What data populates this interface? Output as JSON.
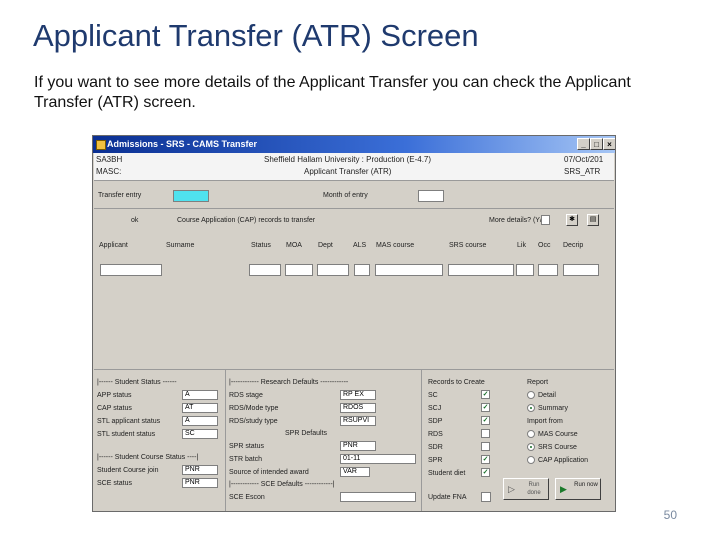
{
  "slide": {
    "title": "Applicant Transfer (ATR) Screen",
    "body": "If you want to see more details of the Applicant Transfer you can check the Applicant Transfer (ATR) screen.",
    "page_number": "50"
  },
  "window": {
    "title": "Admissions - SRS - CAMS Transfer",
    "header": {
      "left_top": "SA3BH",
      "left_bottom": "MASC:",
      "center_top": "Sheffield Hallam University : Production (E-4.7)",
      "center_bottom": "Applicant Transfer (ATR)",
      "right_top": "07/Oct/201",
      "right_bottom": "SRS_ATR"
    },
    "filters": {
      "transfer_label": "Transfer entry",
      "month_label": "Month of entry",
      "ok_label": "ok",
      "records_label": "Course Application (CAP) records to transfer",
      "more_details_label": "More details? (Y/N)"
    },
    "columns": [
      "Applicant",
      "Surname",
      "Status",
      "MOA",
      "Dept",
      "ALS",
      "MAS course",
      "SRS course",
      "Lik",
      "Occ",
      "Decrip"
    ],
    "student_status": {
      "heading": "|------ Student Status ------",
      "rows": [
        {
          "label": "APP status",
          "value": "A"
        },
        {
          "label": "CAP status",
          "value": "AT"
        },
        {
          "label": "STL applicant status",
          "value": "A"
        },
        {
          "label": "STL student status",
          "value": "SC"
        }
      ]
    },
    "course_status": {
      "heading": "|------ Student Course Status ----|",
      "rows": [
        {
          "label": "Student Course join",
          "value": "PNR"
        },
        {
          "label": "SCE status",
          "value": "PNR"
        }
      ]
    },
    "research_defaults": {
      "heading": "|------------ Research Defaults ------------",
      "rows": [
        {
          "label": "RDS stage",
          "value": "RP EX"
        },
        {
          "label": "RDS/Mode type",
          "value": "RDOS"
        },
        {
          "label": "RDS/study type",
          "value": "RSUPVI"
        }
      ],
      "spr_heading": "SPR Defaults",
      "spr_rows": [
        {
          "label": "SPR status",
          "value": "PNR"
        },
        {
          "label": "STR batch",
          "value": "01-11"
        },
        {
          "label": "Source of intended award",
          "value": "VAR"
        }
      ],
      "sce_heading": "|------------ SCE Defaults ------------|",
      "sce_row": {
        "label": "SCE Escon",
        "value": ""
      }
    },
    "records_to_create": {
      "heading": "Records to Create",
      "items": [
        {
          "label": "SC",
          "checked": true
        },
        {
          "label": "SCJ",
          "checked": true
        },
        {
          "label": "SDP",
          "checked": true
        },
        {
          "label": "RDS",
          "checked": false
        },
        {
          "label": "SDR",
          "checked": false
        },
        {
          "label": "SPR",
          "checked": true
        },
        {
          "label": "Student diet",
          "checked": true
        }
      ],
      "update_label": "Update FNA"
    },
    "report": {
      "heading": "Report",
      "options": [
        {
          "label": "Detail",
          "selected": false
        },
        {
          "label": "Summary",
          "selected": true
        }
      ],
      "import_heading": "Import from",
      "import_options": [
        {
          "label": "MAS Course",
          "selected": false
        },
        {
          "label": "SRS Course",
          "selected": true
        },
        {
          "label": "CAP Application",
          "selected": false
        }
      ]
    },
    "buttons": {
      "run_disabled": "Run done",
      "run": "Run now"
    }
  }
}
